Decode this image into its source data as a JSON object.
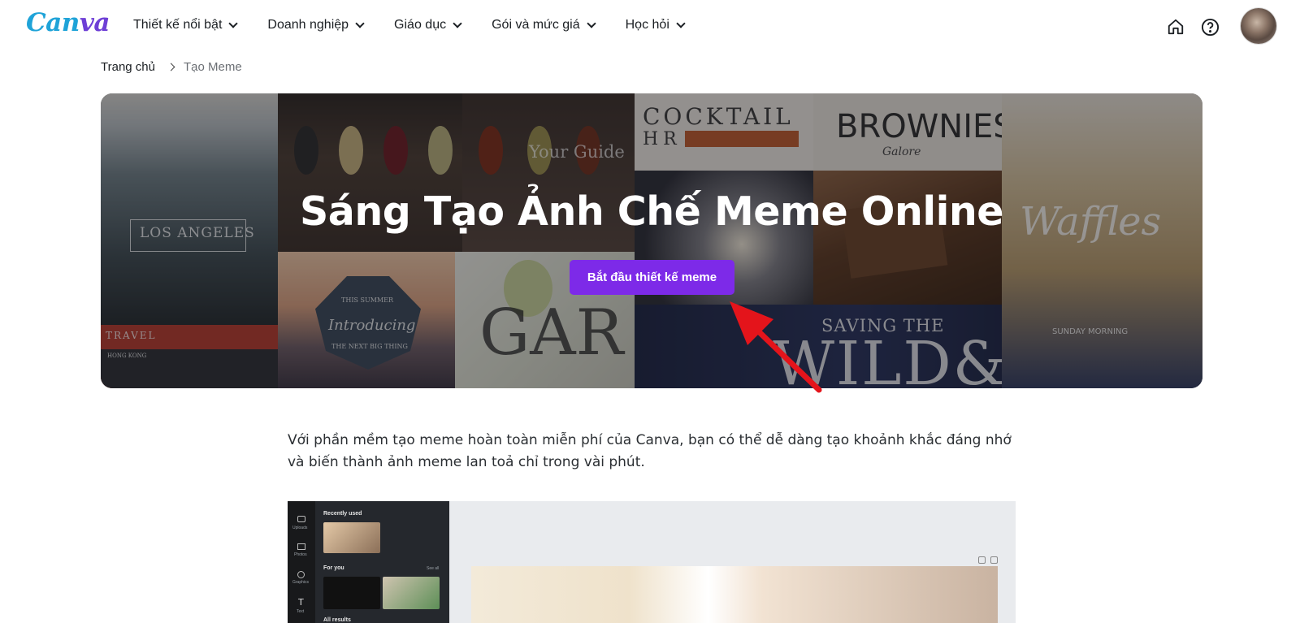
{
  "brand": {
    "logo_text_a": "Can",
    "logo_text_b": "va"
  },
  "nav": {
    "items": [
      {
        "label": "Thiết kế nổi bật"
      },
      {
        "label": "Doanh nghiệp"
      },
      {
        "label": "Giáo dục"
      },
      {
        "label": "Gói và mức giá"
      },
      {
        "label": "Học hỏi"
      }
    ],
    "icons": [
      "home-icon",
      "help-icon"
    ]
  },
  "breadcrumb": {
    "home": "Trang chủ",
    "current": "Tạo Meme"
  },
  "hero": {
    "title": "Sáng Tạo Ảnh Chế Meme Online",
    "cta": "Bắt đầu thiết kế meme",
    "collage_texts": {
      "los_angeles": "LOS ANGELES",
      "your_guide": "Your Guide",
      "cocktail": "COCKTAIL",
      "hr": "HR",
      "brownies": "BROWNIES",
      "galore": "Galore",
      "waffles": "Waffles",
      "sunday": "SUNDAY MORNING",
      "introducing": "Introducing",
      "next_big": "THE NEXT BIG THING",
      "this_summer": "THIS SUMMER",
      "travel": "TRAVEL",
      "hong_kong": "HONG KONG",
      "garden": "GAR",
      "saving": "SAVING THE",
      "wild": "WILD&"
    }
  },
  "description": "Với phần mềm tạo meme hoàn toàn miễn phí của Canva, bạn có thể dễ dàng tạo khoảnh khắc đáng nhớ và biến thành ảnh meme lan toả chỉ trong vài phút.",
  "preview": {
    "recently_used": "Recently used",
    "for_you": "For you",
    "see_all": "See all",
    "all_results": "All results",
    "rail": [
      "Uploads",
      "Photos",
      "Graphics",
      "Text"
    ]
  },
  "colors": {
    "accent": "#7d2ae8",
    "arrow": "#e4141b"
  }
}
